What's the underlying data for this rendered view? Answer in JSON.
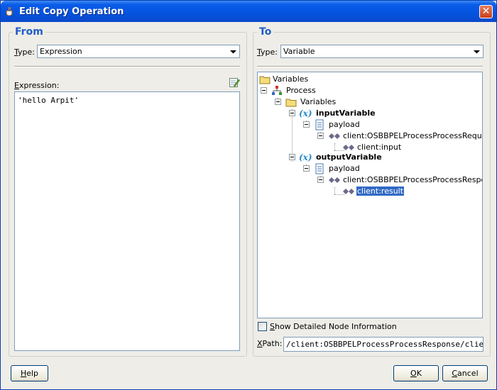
{
  "window": {
    "title": "Edit Copy Operation",
    "close_label": "✕"
  },
  "from": {
    "legend": "From",
    "type_label_u": "T",
    "type_label_rest": "ype:",
    "type_value": "Expression",
    "expression_label_u": "E",
    "expression_label_rest": "xpression:",
    "expression_value": "'hello Arpit'"
  },
  "to": {
    "legend": "To",
    "type_label_u": "T",
    "type_label_rest": "ype:",
    "type_value": "Variable",
    "tree": {
      "root": "Variables",
      "process": "Process",
      "variables": "Variables",
      "input_variable": "inputVariable",
      "input_payload": "payload",
      "input_request": "client:OSBBPELProcessProcessRequest",
      "input_field": "client:input",
      "output_variable": "outputVariable",
      "output_payload": "payload",
      "output_response": "client:OSBBPELProcessProcessResponse",
      "output_field": "client:result"
    },
    "show_detailed_u": "S",
    "show_detailed_rest": "how Detailed Node Information",
    "xpath_label_u": "X",
    "xpath_label_rest": "Path:",
    "xpath_value": "/client:OSBBPELProcessProcessResponse/client:result"
  },
  "buttons": {
    "help_u": "H",
    "help_rest": "elp",
    "ok_u": "O",
    "ok_rest": "K",
    "cancel_u": "C",
    "cancel_rest": "ancel"
  },
  "colors": {
    "accent": "#215dc6",
    "selection": "#316ac5",
    "titlebar": "#0453df"
  }
}
